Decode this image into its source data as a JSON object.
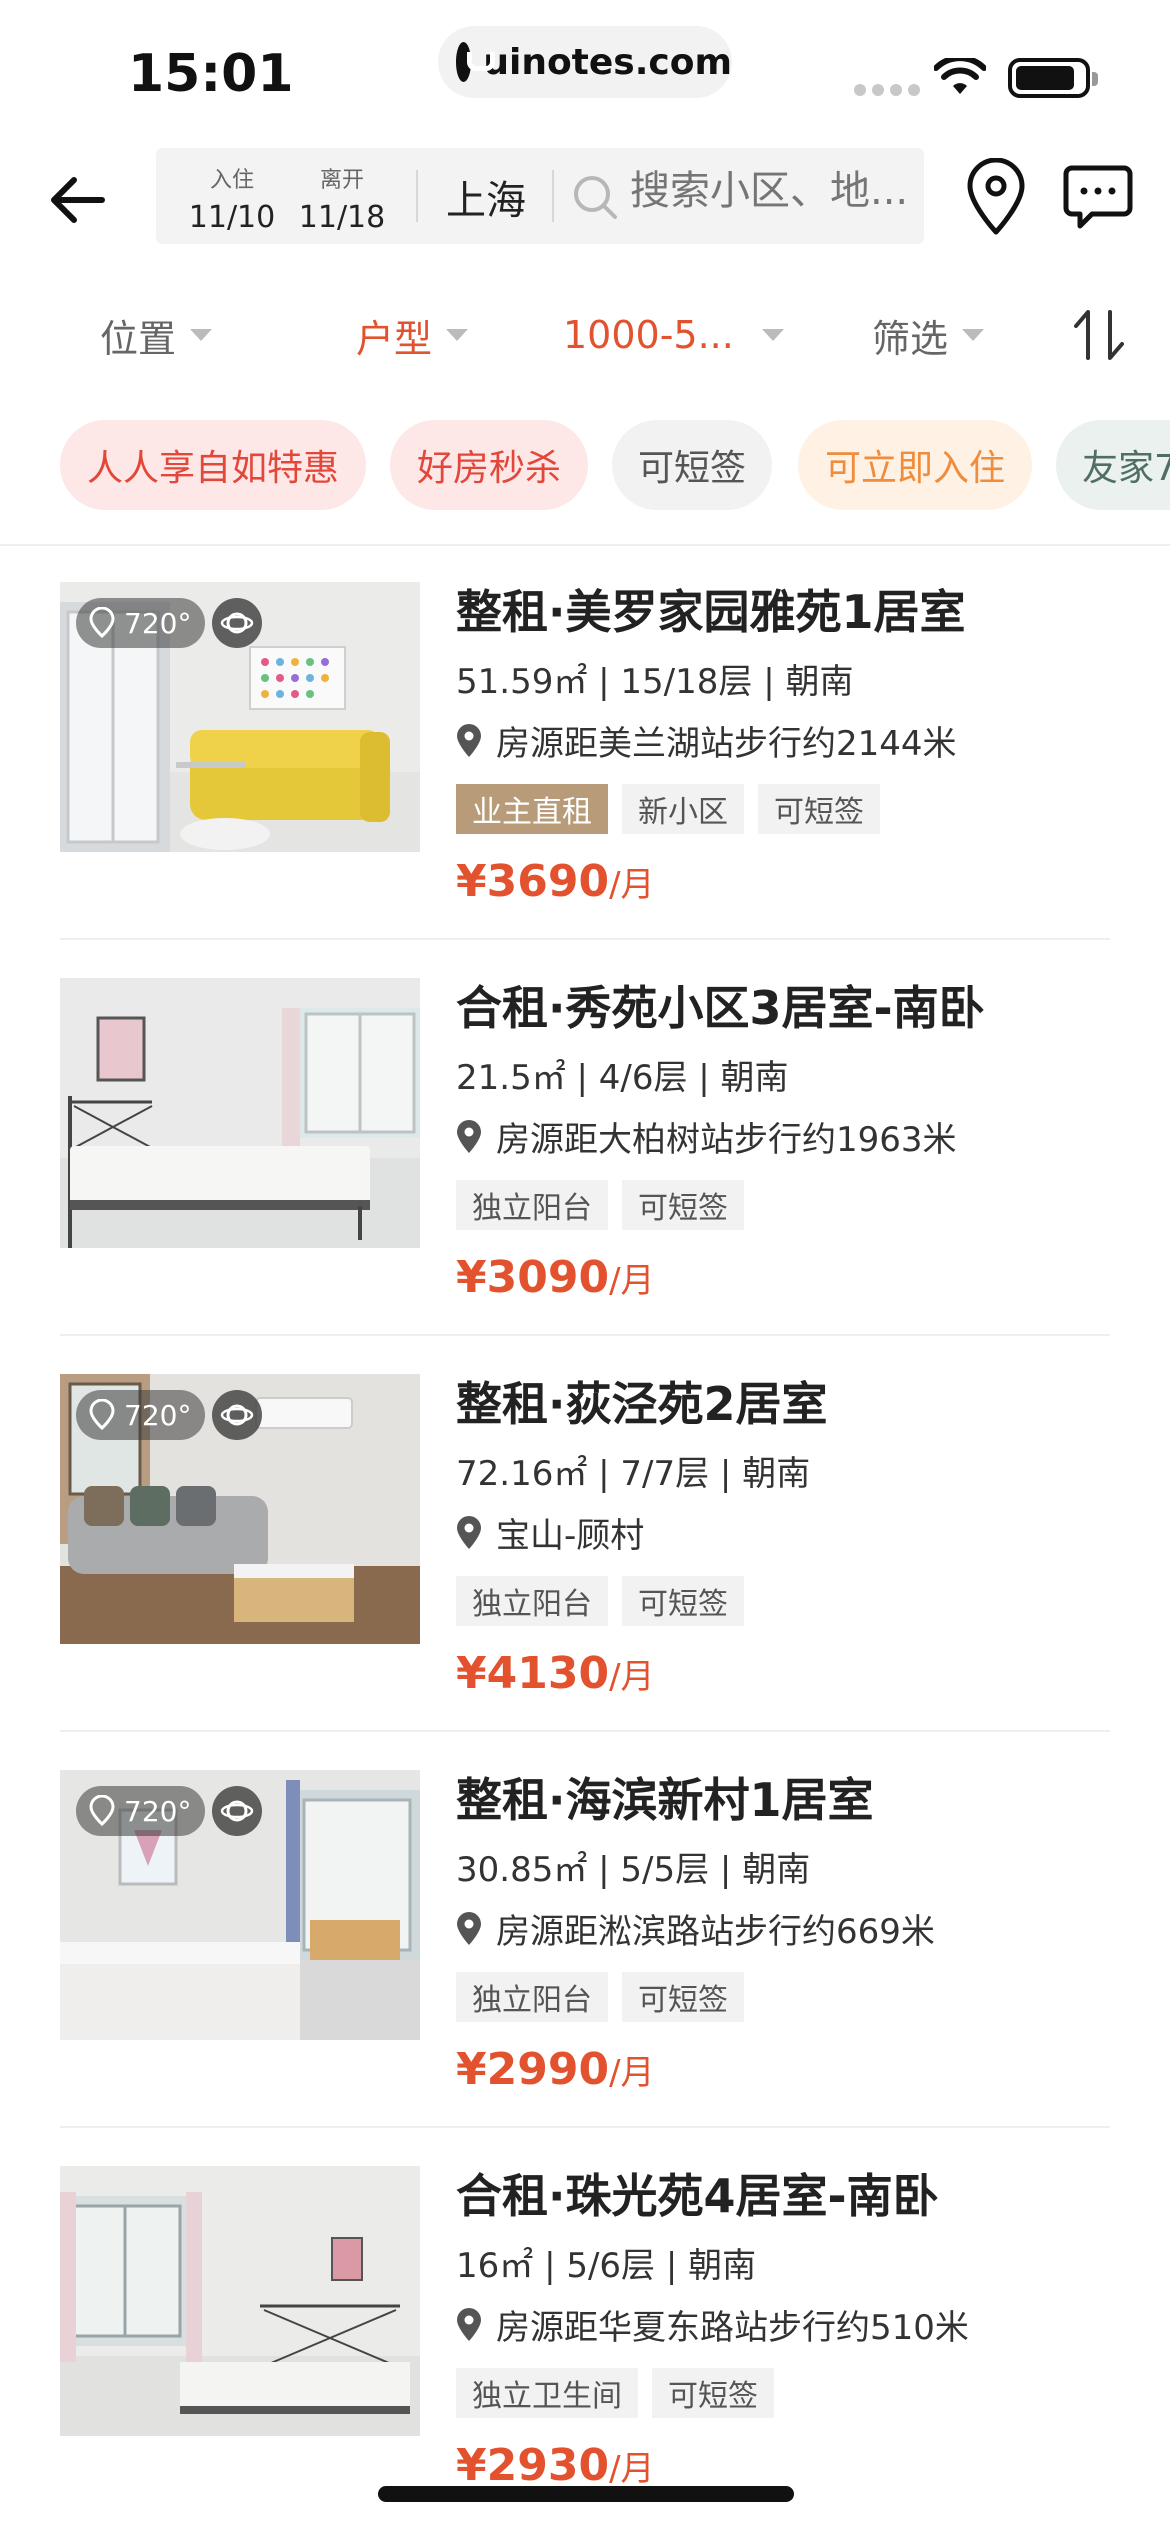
{
  "status_bar": {
    "time": "15:01",
    "url": "uinotes.com"
  },
  "search": {
    "checkin_label": "入住",
    "checkin_date": "11/10",
    "checkout_label": "离开",
    "checkout_date": "11/18",
    "city": "上海",
    "placeholder": "搜索小区、地..."
  },
  "filters": [
    {
      "label": "位置",
      "active": false
    },
    {
      "label": "户型",
      "active": true
    },
    {
      "label": "1000-5...",
      "active": true
    },
    {
      "label": "筛选",
      "active": false
    }
  ],
  "chips": [
    {
      "label": "人人享自如特惠",
      "style": "red"
    },
    {
      "label": "好房秒杀",
      "style": "red"
    },
    {
      "label": "可短签",
      "style": "gray"
    },
    {
      "label": "可立即入住",
      "style": "orange"
    },
    {
      "label": "友家7",
      "style": "teal"
    }
  ],
  "listings": [
    {
      "title": "整租·美罗家园雅苑1居室",
      "meta": "51.59㎡ | 15/18层 | 朝南",
      "location": "房源距美兰湖站步行约2144米",
      "tags": [
        {
          "label": "业主直租",
          "style": "gold"
        },
        {
          "label": "新小区",
          "style": "gray"
        },
        {
          "label": "可短签",
          "style": "gray"
        }
      ],
      "price": "¥3690",
      "unit": "/月",
      "badge_720": "720°"
    },
    {
      "title": "合租·秀苑小区3居室-南卧",
      "meta": "21.5㎡ | 4/6层 | 朝南",
      "location": "房源距大柏树站步行约1963米",
      "tags": [
        {
          "label": "独立阳台",
          "style": "gray"
        },
        {
          "label": "可短签",
          "style": "gray"
        }
      ],
      "price": "¥3090",
      "unit": "/月",
      "badge_720": ""
    },
    {
      "title": "整租·荻泾苑2居室",
      "meta": "72.16㎡ | 7/7层 | 朝南",
      "location": "宝山-顾村",
      "tags": [
        {
          "label": "独立阳台",
          "style": "gray"
        },
        {
          "label": "可短签",
          "style": "gray"
        }
      ],
      "price": "¥4130",
      "unit": "/月",
      "badge_720": "720°"
    },
    {
      "title": "整租·海滨新村1居室",
      "meta": "30.85㎡ | 5/5层 | 朝南",
      "location": "房源距淞滨路站步行约669米",
      "tags": [
        {
          "label": "独立阳台",
          "style": "gray"
        },
        {
          "label": "可短签",
          "style": "gray"
        }
      ],
      "price": "¥2990",
      "unit": "/月",
      "badge_720": "720°"
    },
    {
      "title": "合租·珠光苑4居室-南卧",
      "meta": "16㎡ | 5/6层 | 朝南",
      "location": "房源距华夏东路站步行约510米",
      "tags": [
        {
          "label": "独立卫生间",
          "style": "gray"
        },
        {
          "label": "可短签",
          "style": "gray"
        }
      ],
      "price": "¥2930",
      "unit": "/月",
      "badge_720": ""
    }
  ],
  "colors": {
    "accent": "#e2522e",
    "chip_red_bg": "#fde7e7",
    "chip_orange_text": "#ef8d3e",
    "tag_gold_bg": "#b89b78"
  }
}
